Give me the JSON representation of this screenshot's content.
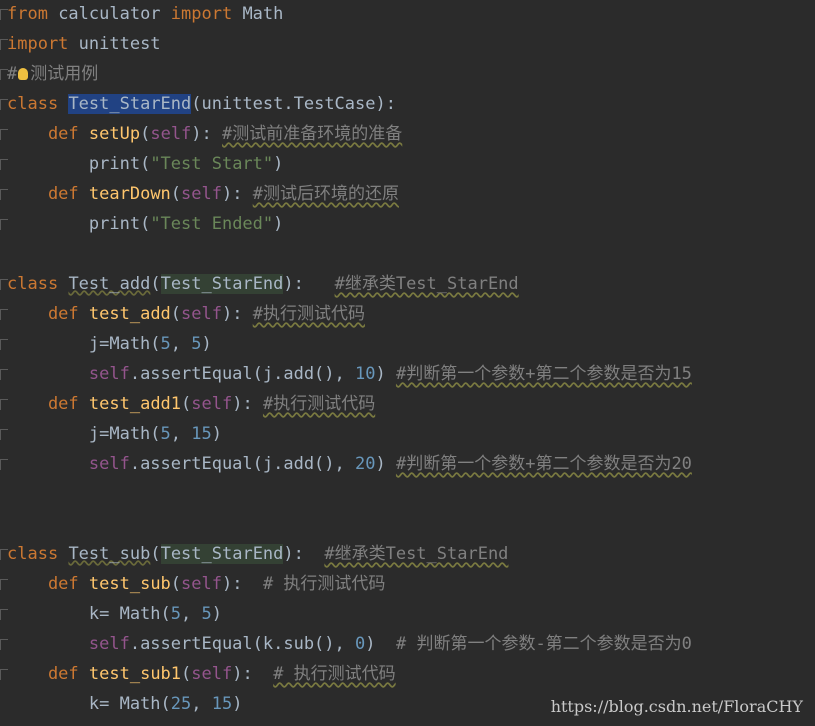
{
  "editor": {
    "lines": [
      {
        "parts": [
          {
            "t": "from",
            "c": "kw"
          },
          {
            "t": " calculator ",
            "c": "plain"
          },
          {
            "t": "import",
            "c": "kw"
          },
          {
            "t": " Math",
            "c": "plain"
          }
        ]
      },
      {
        "parts": [
          {
            "t": "import",
            "c": "kw"
          },
          {
            "t": " unittest",
            "c": "plain"
          }
        ]
      },
      {
        "parts": [
          {
            "t": "#",
            "c": "cmt"
          },
          {
            "t": "bulb",
            "c": "bulb"
          },
          {
            "t": "测试用例",
            "c": "cmt"
          }
        ]
      },
      {
        "parts": [
          {
            "t": "class",
            "c": "kw"
          },
          {
            "t": " ",
            "c": "plain"
          },
          {
            "t": "Test_StarEnd",
            "c": "sel"
          },
          {
            "t": "(unittest.TestCase):",
            "c": "plain"
          }
        ]
      },
      {
        "parts": [
          {
            "t": "    def",
            "c": "kw"
          },
          {
            "t": " ",
            "c": "plain"
          },
          {
            "t": "setUp",
            "c": "fn"
          },
          {
            "t": "(",
            "c": "plain"
          },
          {
            "t": "self",
            "c": "self"
          },
          {
            "t": "): ",
            "c": "plain"
          },
          {
            "t": "#测试前准备环境的准备",
            "c": "cmt squig"
          }
        ]
      },
      {
        "parts": [
          {
            "t": "        print",
            "c": "plain"
          },
          {
            "t": "(",
            "c": "plain"
          },
          {
            "t": "\"Test Start\"",
            "c": "str"
          },
          {
            "t": ")",
            "c": "plain"
          }
        ]
      },
      {
        "parts": [
          {
            "t": "    def",
            "c": "kw"
          },
          {
            "t": " ",
            "c": "plain"
          },
          {
            "t": "tearDown",
            "c": "fn"
          },
          {
            "t": "(",
            "c": "plain"
          },
          {
            "t": "self",
            "c": "self"
          },
          {
            "t": "): ",
            "c": "plain"
          },
          {
            "t": "#测试后环境的还原",
            "c": "cmt squig"
          }
        ]
      },
      {
        "parts": [
          {
            "t": "        print",
            "c": "plain"
          },
          {
            "t": "(",
            "c": "plain"
          },
          {
            "t": "\"Test Ended\"",
            "c": "str"
          },
          {
            "t": ")",
            "c": "plain"
          }
        ]
      },
      {
        "parts": []
      },
      {
        "parts": [
          {
            "t": "class",
            "c": "kw"
          },
          {
            "t": " ",
            "c": "plain"
          },
          {
            "t": "Test_add",
            "c": "cls"
          },
          {
            "t": "(",
            "c": "plain"
          },
          {
            "t": "Test_StarEnd",
            "c": "hl"
          },
          {
            "t": "):   ",
            "c": "plain"
          },
          {
            "t": "#继承类Test_StarEnd",
            "c": "cmt squig"
          }
        ]
      },
      {
        "parts": [
          {
            "t": "    def",
            "c": "kw"
          },
          {
            "t": " ",
            "c": "plain"
          },
          {
            "t": "test_add",
            "c": "fn"
          },
          {
            "t": "(",
            "c": "plain"
          },
          {
            "t": "self",
            "c": "self"
          },
          {
            "t": "): ",
            "c": "plain"
          },
          {
            "t": "#执行测试代码",
            "c": "cmt squig"
          }
        ]
      },
      {
        "parts": [
          {
            "t": "        j=Math",
            "c": "plain"
          },
          {
            "t": "(",
            "c": "plain"
          },
          {
            "t": "5",
            "c": "num"
          },
          {
            "t": ", ",
            "c": "plain"
          },
          {
            "t": "5",
            "c": "num"
          },
          {
            "t": ")",
            "c": "plain"
          }
        ]
      },
      {
        "parts": [
          {
            "t": "        self",
            "c": "self"
          },
          {
            "t": ".assertEqual(j.add(), ",
            "c": "plain"
          },
          {
            "t": "10",
            "c": "num"
          },
          {
            "t": ") ",
            "c": "plain"
          },
          {
            "t": "#判断第一个参数+第二个参数是否为15",
            "c": "cmt squig"
          }
        ]
      },
      {
        "parts": [
          {
            "t": "    def",
            "c": "kw"
          },
          {
            "t": " ",
            "c": "plain"
          },
          {
            "t": "test_add1",
            "c": "fn"
          },
          {
            "t": "(",
            "c": "plain"
          },
          {
            "t": "self",
            "c": "self"
          },
          {
            "t": "): ",
            "c": "plain"
          },
          {
            "t": "#执行测试代码",
            "c": "cmt squig"
          }
        ]
      },
      {
        "parts": [
          {
            "t": "        j=Math",
            "c": "plain"
          },
          {
            "t": "(",
            "c": "plain"
          },
          {
            "t": "5",
            "c": "num"
          },
          {
            "t": ", ",
            "c": "plain"
          },
          {
            "t": "15",
            "c": "num"
          },
          {
            "t": ")",
            "c": "plain"
          }
        ]
      },
      {
        "parts": [
          {
            "t": "        self",
            "c": "self"
          },
          {
            "t": ".assertEqual(j.add(), ",
            "c": "plain"
          },
          {
            "t": "20",
            "c": "num"
          },
          {
            "t": ") ",
            "c": "plain"
          },
          {
            "t": "#判断第一个参数+第二个参数是否为20",
            "c": "cmt squig"
          }
        ]
      },
      {
        "parts": []
      },
      {
        "parts": []
      },
      {
        "parts": [
          {
            "t": "class",
            "c": "kw"
          },
          {
            "t": " ",
            "c": "plain"
          },
          {
            "t": "Test_sub",
            "c": "cls"
          },
          {
            "t": "(",
            "c": "plain"
          },
          {
            "t": "Test_StarEnd",
            "c": "hl"
          },
          {
            "t": "):  ",
            "c": "plain"
          },
          {
            "t": "#继承类Test_StarEnd",
            "c": "cmt squig"
          }
        ]
      },
      {
        "parts": [
          {
            "t": "    def",
            "c": "kw"
          },
          {
            "t": " ",
            "c": "plain"
          },
          {
            "t": "test_sub",
            "c": "fn"
          },
          {
            "t": "(",
            "c": "plain"
          },
          {
            "t": "self",
            "c": "self"
          },
          {
            "t": "):  ",
            "c": "plain"
          },
          {
            "t": "# 执行测试代码",
            "c": "cmt"
          }
        ]
      },
      {
        "parts": [
          {
            "t": "        k= Math",
            "c": "plain"
          },
          {
            "t": "(",
            "c": "plain"
          },
          {
            "t": "5",
            "c": "num"
          },
          {
            "t": ", ",
            "c": "plain"
          },
          {
            "t": "5",
            "c": "num"
          },
          {
            "t": ")",
            "c": "plain"
          }
        ]
      },
      {
        "parts": [
          {
            "t": "        self",
            "c": "self"
          },
          {
            "t": ".assertEqual(k.sub(), ",
            "c": "plain"
          },
          {
            "t": "0",
            "c": "num"
          },
          {
            "t": ")  ",
            "c": "plain"
          },
          {
            "t": "# 判断第一个参数-第二个参数是否为0",
            "c": "cmt"
          }
        ]
      },
      {
        "parts": [
          {
            "t": "    def",
            "c": "kw"
          },
          {
            "t": " ",
            "c": "plain"
          },
          {
            "t": "test_sub1",
            "c": "fn"
          },
          {
            "t": "(",
            "c": "plain"
          },
          {
            "t": "self",
            "c": "self"
          },
          {
            "t": "):  ",
            "c": "plain"
          },
          {
            "t": "# 执行测试代码",
            "c": "cmt squig"
          }
        ]
      },
      {
        "parts": [
          {
            "t": "        k= Math",
            "c": "plain"
          },
          {
            "t": "(",
            "c": "plain"
          },
          {
            "t": "25",
            "c": "num"
          },
          {
            "t": ", ",
            "c": "plain"
          },
          {
            "t": "15",
            "c": "num"
          },
          {
            "t": ")",
            "c": "plain"
          }
        ]
      }
    ]
  },
  "watermark": "https://blog.csdn.net/FloraCHY"
}
